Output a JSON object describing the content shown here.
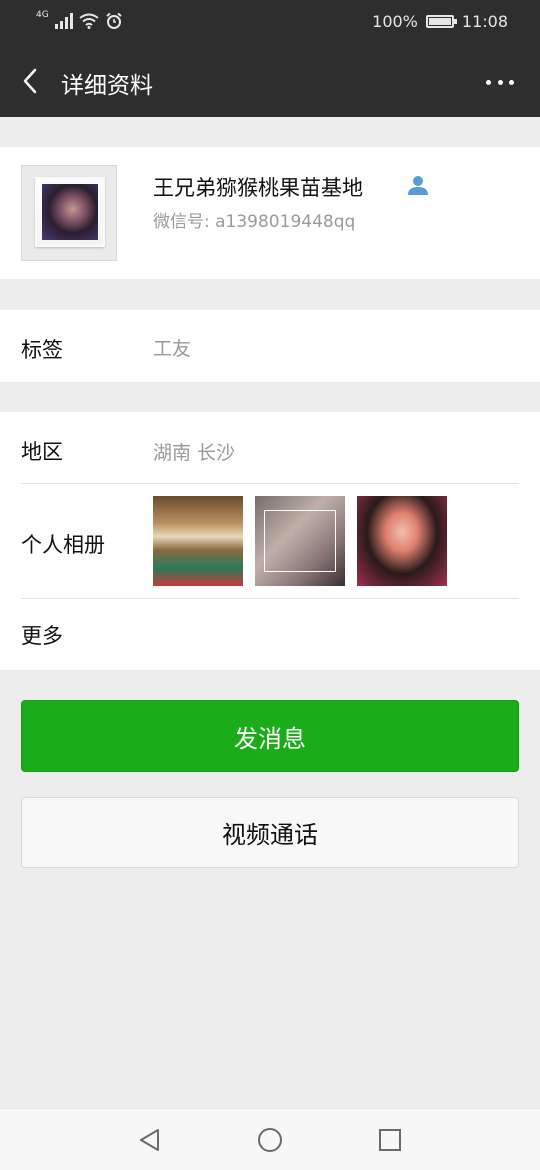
{
  "status_bar": {
    "network": "4G",
    "battery": "100%",
    "time": "11:08"
  },
  "header": {
    "title": "详细资料"
  },
  "profile": {
    "nickname": "王兄弟猕猴桃果苗基地",
    "wechat_id": "微信号: a1398019448qq"
  },
  "tags": {
    "label": "标签",
    "value": "工友"
  },
  "info": {
    "region_label": "地区",
    "region_value": "湖南  长沙",
    "album_label": "个人相册",
    "more_label": "更多"
  },
  "actions": {
    "send_message": "发消息",
    "video_call": "视频通话"
  },
  "colors": {
    "header_bg": "#2e2e2e",
    "primary_button": "#1aad19",
    "contact_icon": "#5a9bd5"
  },
  "icons": [
    "back-icon",
    "more-icon",
    "contact-icon",
    "signal-icon",
    "wifi-icon",
    "alarm-icon",
    "battery-icon",
    "nav-back-icon",
    "nav-home-icon",
    "nav-recent-icon"
  ]
}
